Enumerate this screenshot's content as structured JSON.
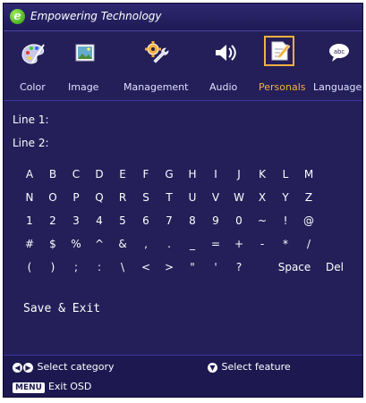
{
  "header": {
    "title": "Empowering Technology",
    "logo_letter": "e"
  },
  "tabs": [
    {
      "label": "Color",
      "icon": "palette-icon"
    },
    {
      "label": "Image",
      "icon": "picture-icon"
    },
    {
      "label": "Management",
      "icon": "gear-wrench-icon"
    },
    {
      "label": "Audio",
      "icon": "speaker-icon"
    },
    {
      "label": "Personals",
      "icon": "document-pen-icon",
      "active": true
    },
    {
      "label": "Language",
      "icon": "speech-bubble-icon"
    }
  ],
  "lines": {
    "line1": "Line 1:",
    "line2": "Line 2:"
  },
  "keyboard": {
    "rows": [
      [
        "A",
        "B",
        "C",
        "D",
        "E",
        "F",
        "G",
        "H",
        "I",
        "J",
        "K",
        "L",
        "M"
      ],
      [
        "N",
        "O",
        "P",
        "Q",
        "R",
        "S",
        "T",
        "U",
        "V",
        "W",
        "X",
        "Y",
        "Z"
      ],
      [
        "1",
        "2",
        "3",
        "4",
        "5",
        "6",
        "7",
        "8",
        "9",
        "0",
        "~",
        "!",
        "@"
      ],
      [
        "#",
        "$",
        "%",
        "^",
        "&",
        ",",
        ".",
        "_",
        "=",
        "+",
        "-",
        "*",
        "/"
      ],
      [
        "(",
        ")",
        ";",
        ":",
        "\\",
        "<",
        ">",
        "\"",
        "'",
        "?",
        "Space",
        "Del"
      ]
    ]
  },
  "save_exit": "Save & Exit",
  "footer": {
    "select_category": "Select category",
    "select_feature": "Select feature",
    "menu_badge": "MENU",
    "exit_osd": "Exit OSD"
  },
  "colors": {
    "background": "#241f59",
    "accent": "#f4b040"
  }
}
